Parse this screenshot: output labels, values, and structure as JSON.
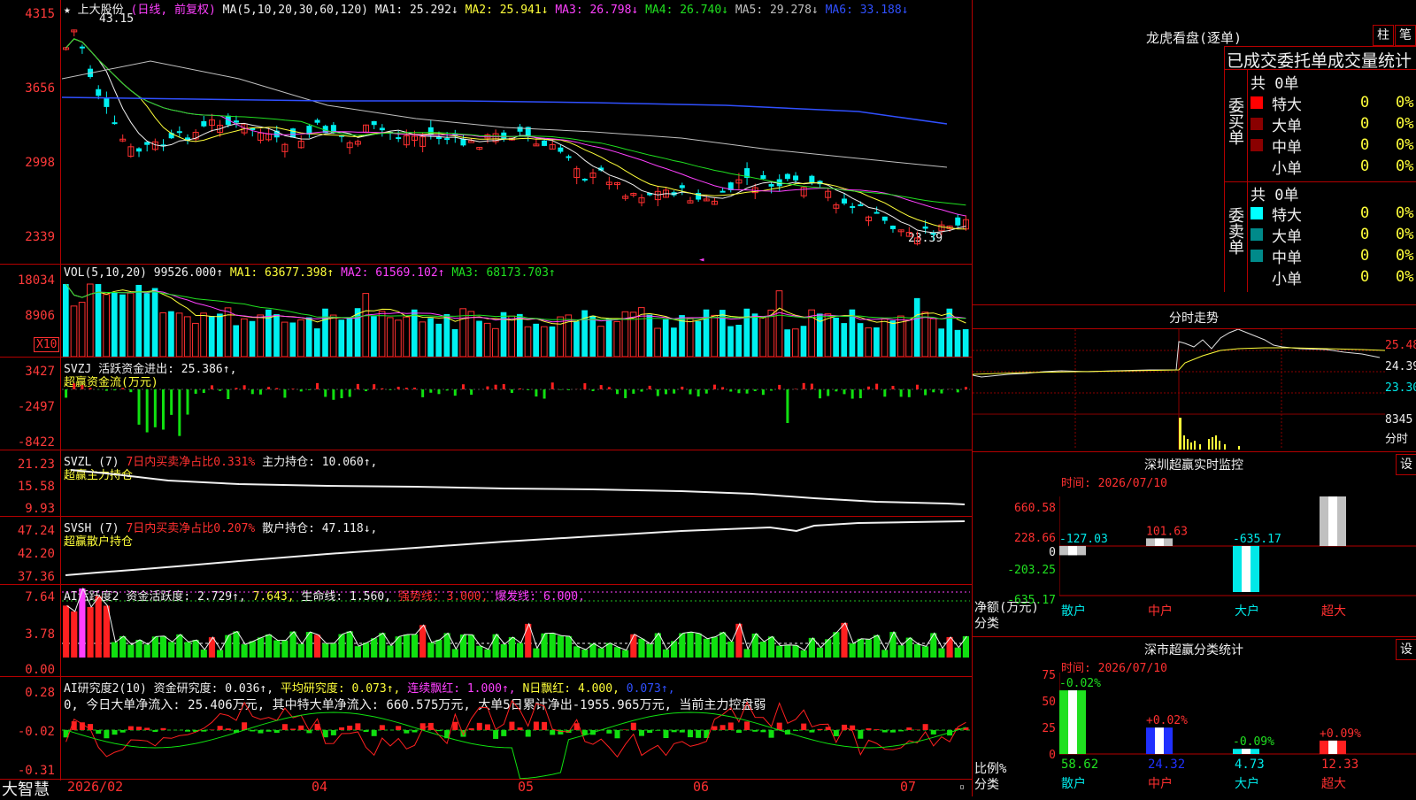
{
  "kline": {
    "title": "上大股份",
    "mode": "(日线, 前复权)",
    "ma_spec": "MA(5,10,20,30,60,120)",
    "ma_values": [
      {
        "label": "MA1: 25.292↓",
        "color": "#f0f0f0"
      },
      {
        "label": "MA2: 25.941↓",
        "color": "#ffff3a"
      },
      {
        "label": "MA3: 26.798↓",
        "color": "#ff40ff"
      },
      {
        "label": "MA4: 26.740↓",
        "color": "#20e020"
      },
      {
        "label": "MA5: 29.278↓",
        "color": "#c0c0c0"
      },
      {
        "label": "MA6: 33.188↓",
        "color": "#3050ff"
      }
    ],
    "y_labels": [
      "4315",
      "3656",
      "2998",
      "2339"
    ],
    "high_label": "43.15",
    "low_label": "23.39"
  },
  "vol": {
    "header": "VOL(5,10,20)",
    "value": "99526.000↑",
    "ma1": "MA1: 63677.398↑",
    "ma2": "MA2: 61569.102↑",
    "ma3": "MA3: 68173.703↑",
    "y_labels": [
      "18034",
      "8906"
    ],
    "unit": "X10"
  },
  "svzj": {
    "header": "SVZJ  活跃资金进出: 25.386↑,",
    "sub": "超赢资金流(万元)",
    "y_labels": [
      "3427",
      "-2497",
      "-8422"
    ]
  },
  "svzl": {
    "header": "SVZL (7)",
    "ratio": "7日内买卖净占比0.331%",
    "hold": "主力持仓: 10.060↑,",
    "sub": "超赢主力持仓",
    "y_labels": [
      "21.23",
      "15.58",
      "9.93"
    ]
  },
  "svsh": {
    "header": "SVSH (7)",
    "ratio": "7日内买卖净占比0.207%",
    "hold": "散户持仓: 47.118↓,",
    "sub": "超赢散户持仓",
    "y_labels": [
      "47.24",
      "42.20",
      "37.36"
    ]
  },
  "ai1": {
    "header": "AI活跃度2",
    "v1": "资金活跃度: 2.729↑,",
    "v2": "7.643,",
    "v3": "生命线: 1.560,",
    "v4": "强势线: 3.000,",
    "v5": "爆发线: 6.000,",
    "y_labels": [
      "7.64",
      "3.78",
      "0.00"
    ]
  },
  "ai2": {
    "header": "AI研究度2(10)",
    "v1": "资金研究度: 0.036↑,",
    "v2": "平均研究度: 0.073↑,",
    "v3": "连续飘红: 1.000↑,",
    "v4": "N日飘红: 4.000,",
    "v5": "0.073↑,",
    "text": "0, 今日大单净流入: 25.406万元, 其中特大单净流入: 660.575万元, 大单5日累计净出-1955.965万元, 当前主力控盘弱",
    "y_labels": [
      "0.28",
      "-0.02",
      "-0.31"
    ]
  },
  "xaxis": {
    "labels": [
      "2026/02",
      "04",
      "05",
      "06",
      "07"
    ]
  },
  "footer": {
    "brand": "大智慧"
  },
  "lhb": {
    "title": "龙虎看盘(逐单)",
    "btn1": "柱",
    "btn2": "笔",
    "subtitle": "已成交委托单成交量统计",
    "buy_side": "委买单",
    "sell_side": "委卖单",
    "buy_total": "共 0单",
    "sell_total": "共 0单",
    "buy_rows": [
      {
        "name": "特大",
        "count": "0",
        "pct": "0%",
        "color": "#ff0000"
      },
      {
        "name": "大单",
        "count": "0",
        "pct": "0%",
        "color": "#8a0000"
      },
      {
        "name": "中单",
        "count": "0",
        "pct": "0%",
        "color": "#8a0000"
      },
      {
        "name": "小单",
        "count": "0",
        "pct": "0%",
        "color": "#000000"
      }
    ],
    "sell_rows": [
      {
        "name": "特大",
        "count": "0",
        "pct": "0%",
        "color": "#00ffff"
      },
      {
        "name": "大单",
        "count": "0",
        "pct": "0%",
        "color": "#008a8a"
      },
      {
        "name": "中单",
        "count": "0",
        "pct": "0%",
        "color": "#008a8a"
      },
      {
        "name": "小单",
        "count": "0",
        "pct": "0%",
        "color": "#000000"
      }
    ]
  },
  "intraday": {
    "title": "分时走势",
    "y_labels": [
      "25.48",
      "24.39",
      "23.30"
    ],
    "vol_label": "8345",
    "unit": "分时"
  },
  "monitor": {
    "title": "深圳超赢实时监控",
    "btn": "设",
    "time": "时间: 2026/07/10",
    "y_labels": [
      "660.58",
      "228.66",
      "0",
      "-203.25",
      "-635.17"
    ],
    "axis_title": "净额(万元)",
    "cat_title": "分类",
    "chart_data": {
      "type": "bar",
      "categories": [
        "散户",
        "中户",
        "大户",
        "超大"
      ],
      "values": [
        -127.03,
        101.63,
        -635.17,
        660.58
      ],
      "ylim": [
        -635.17,
        660.58
      ]
    },
    "value_labels": [
      "-127.03",
      "101.63",
      "-635.17",
      "660.58"
    ]
  },
  "classify": {
    "title": "深市超赢分类统计",
    "btn": "设",
    "time": "时间: 2026/07/10",
    "y_labels": [
      "75",
      "50",
      "25",
      "0"
    ],
    "axis_title": "比例%",
    "cat_title": "分类",
    "chart_data": {
      "type": "bar",
      "categories": [
        "散户",
        "中户",
        "大户",
        "超大"
      ],
      "values": [
        58.62,
        24.32,
        4.73,
        12.33
      ],
      "changes": [
        "-0.02%",
        "+0.02%",
        "-0.09%",
        "+0.09%"
      ],
      "ylim": [
        0,
        75
      ]
    },
    "value_labels": [
      "58.62",
      "24.32",
      "4.73",
      "12.33"
    ]
  }
}
